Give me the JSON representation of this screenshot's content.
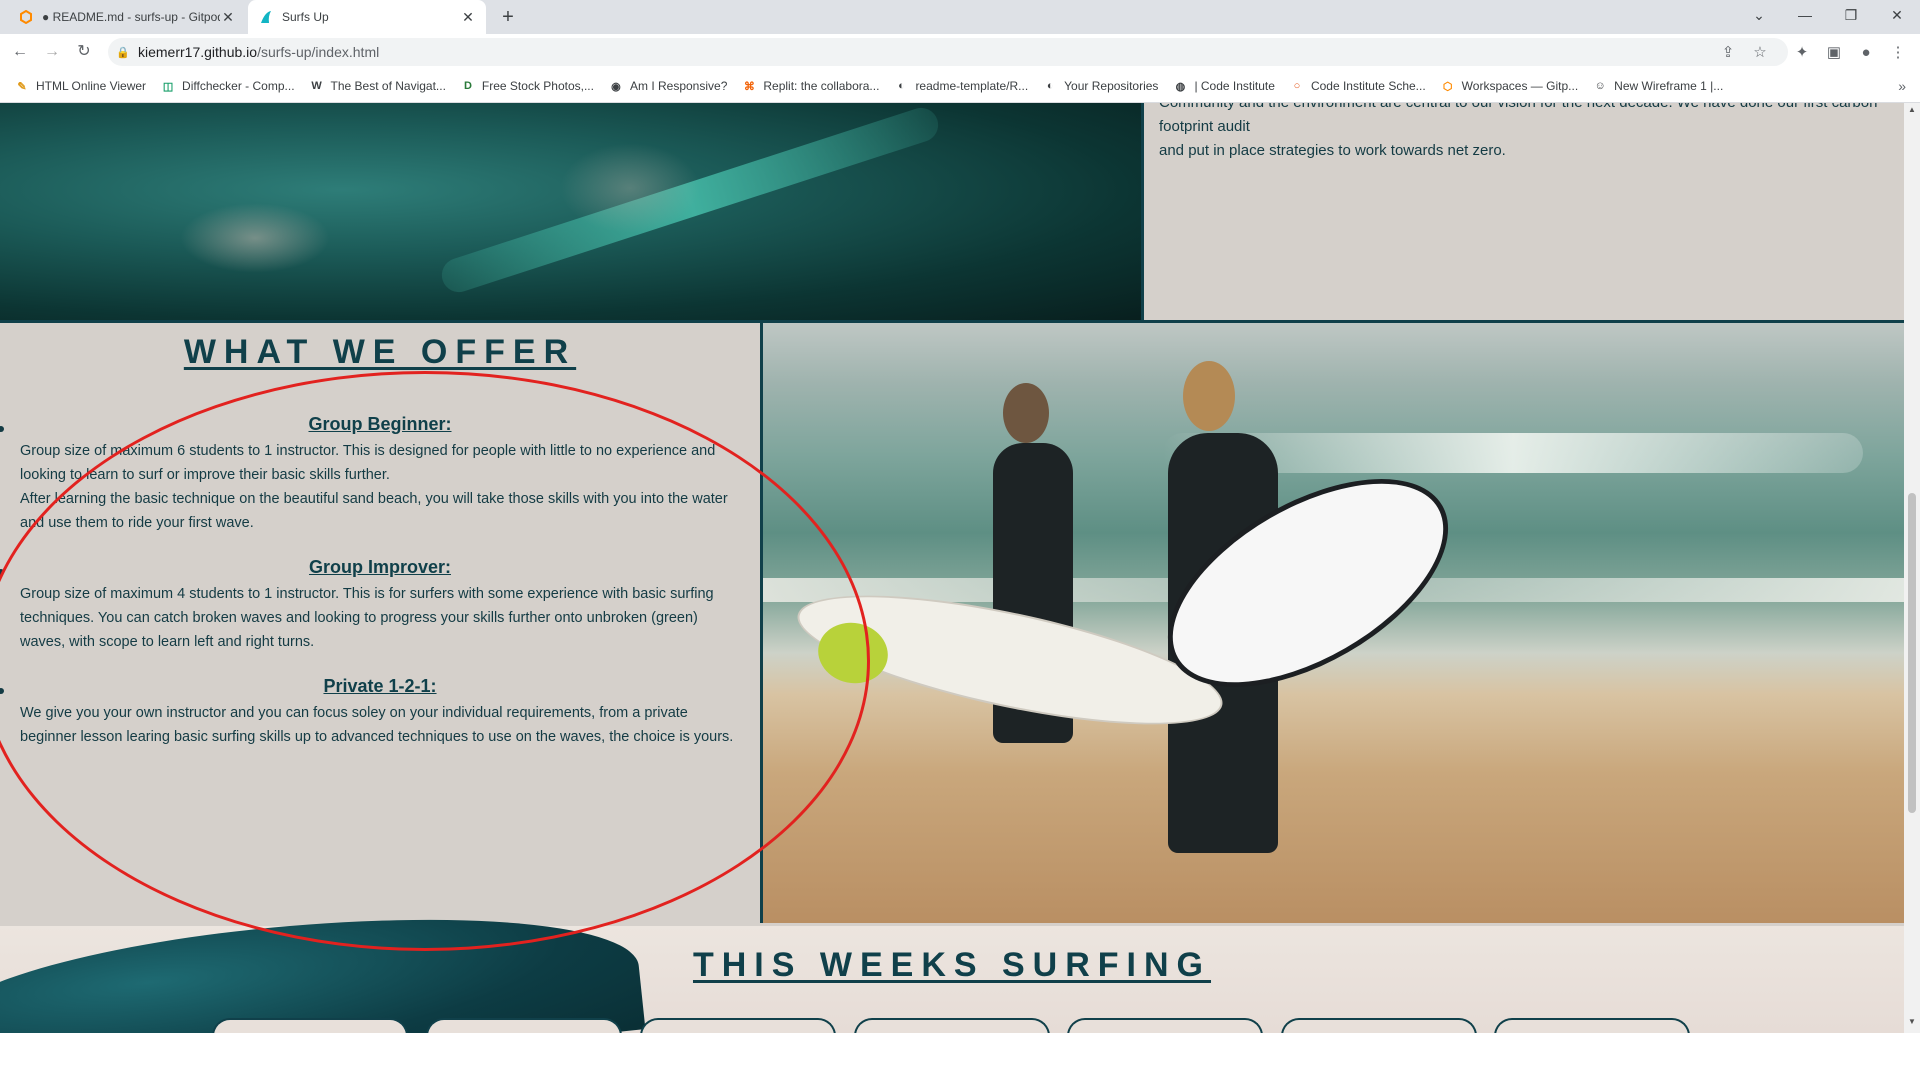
{
  "browser": {
    "tabs": [
      {
        "title": "● README.md - surfs-up - Gitpod",
        "active": false
      },
      {
        "title": "Surfs Up",
        "active": true
      }
    ],
    "new_tab_label": "+",
    "url_domain": "kiemerr17.github.io",
    "url_path": "/surfs-up/index.html",
    "bookmarks": [
      {
        "label": "HTML Online Viewer",
        "icon": "html-viewer-icon"
      },
      {
        "label": "Diffchecker - Comp...",
        "icon": "diffchecker-icon"
      },
      {
        "label": "The Best of Navigat...",
        "icon": "w-icon"
      },
      {
        "label": "Free Stock Photos,...",
        "icon": "stock-photos-icon"
      },
      {
        "label": "Am I Responsive?",
        "icon": "responsive-icon"
      },
      {
        "label": "Replit: the collabora...",
        "icon": "replit-icon"
      },
      {
        "label": "readme-template/R...",
        "icon": "github-icon"
      },
      {
        "label": "Your Repositories",
        "icon": "github-icon"
      },
      {
        "label": "| Code Institute",
        "icon": "code-institute-icon"
      },
      {
        "label": "Code Institute Sche...",
        "icon": "code-institute-schedule-icon"
      },
      {
        "label": "Workspaces — Gitp...",
        "icon": "gitpod-icon"
      },
      {
        "label": "New Wireframe 1 |...",
        "icon": "wireframe-icon"
      }
    ],
    "bookmarks_more": "»"
  },
  "page": {
    "about_text_line1": "Community and the environment are central to our vision for the next decade. We have done our first carbon footprint audit",
    "about_text_line2": "and put in place strategies to work towards net zero.",
    "offer": {
      "title": "WHAT WE OFFER",
      "items": [
        {
          "heading": "Group Beginner:",
          "paragraph1": "Group size of maximum 6 students to 1 instructor. This is designed for people with little to no experience and looking to learn to surf or improve their basic skills further.",
          "paragraph2": "After learning the basic technique on the beautiful sand beach, you will take those skills with you into the water and use them to ride your first wave."
        },
        {
          "heading": "Group Improver:",
          "paragraph1": "Group size of maximum 4 students to 1 instructor. This is for surfers with some experience with basic surfing techniques. You can catch broken waves and looking to progress your skills further onto unbroken (green) waves, with scope to learn left and right turns."
        },
        {
          "heading": "Private 1-2-1:",
          "paragraph1": "We give you your own instructor and you can focus soley on your individual requirements, from a private beginner lesson learing basic surfing skills up to advanced techniques to use on the waves, the choice is yours."
        }
      ]
    },
    "schedule": {
      "title": "THIS WEEKS SURFING",
      "day_tab_count": 7
    }
  },
  "colors": {
    "brand_dark": "#10404a",
    "panel_bg": "#d5d0cb",
    "annotation": "#e2221f"
  }
}
